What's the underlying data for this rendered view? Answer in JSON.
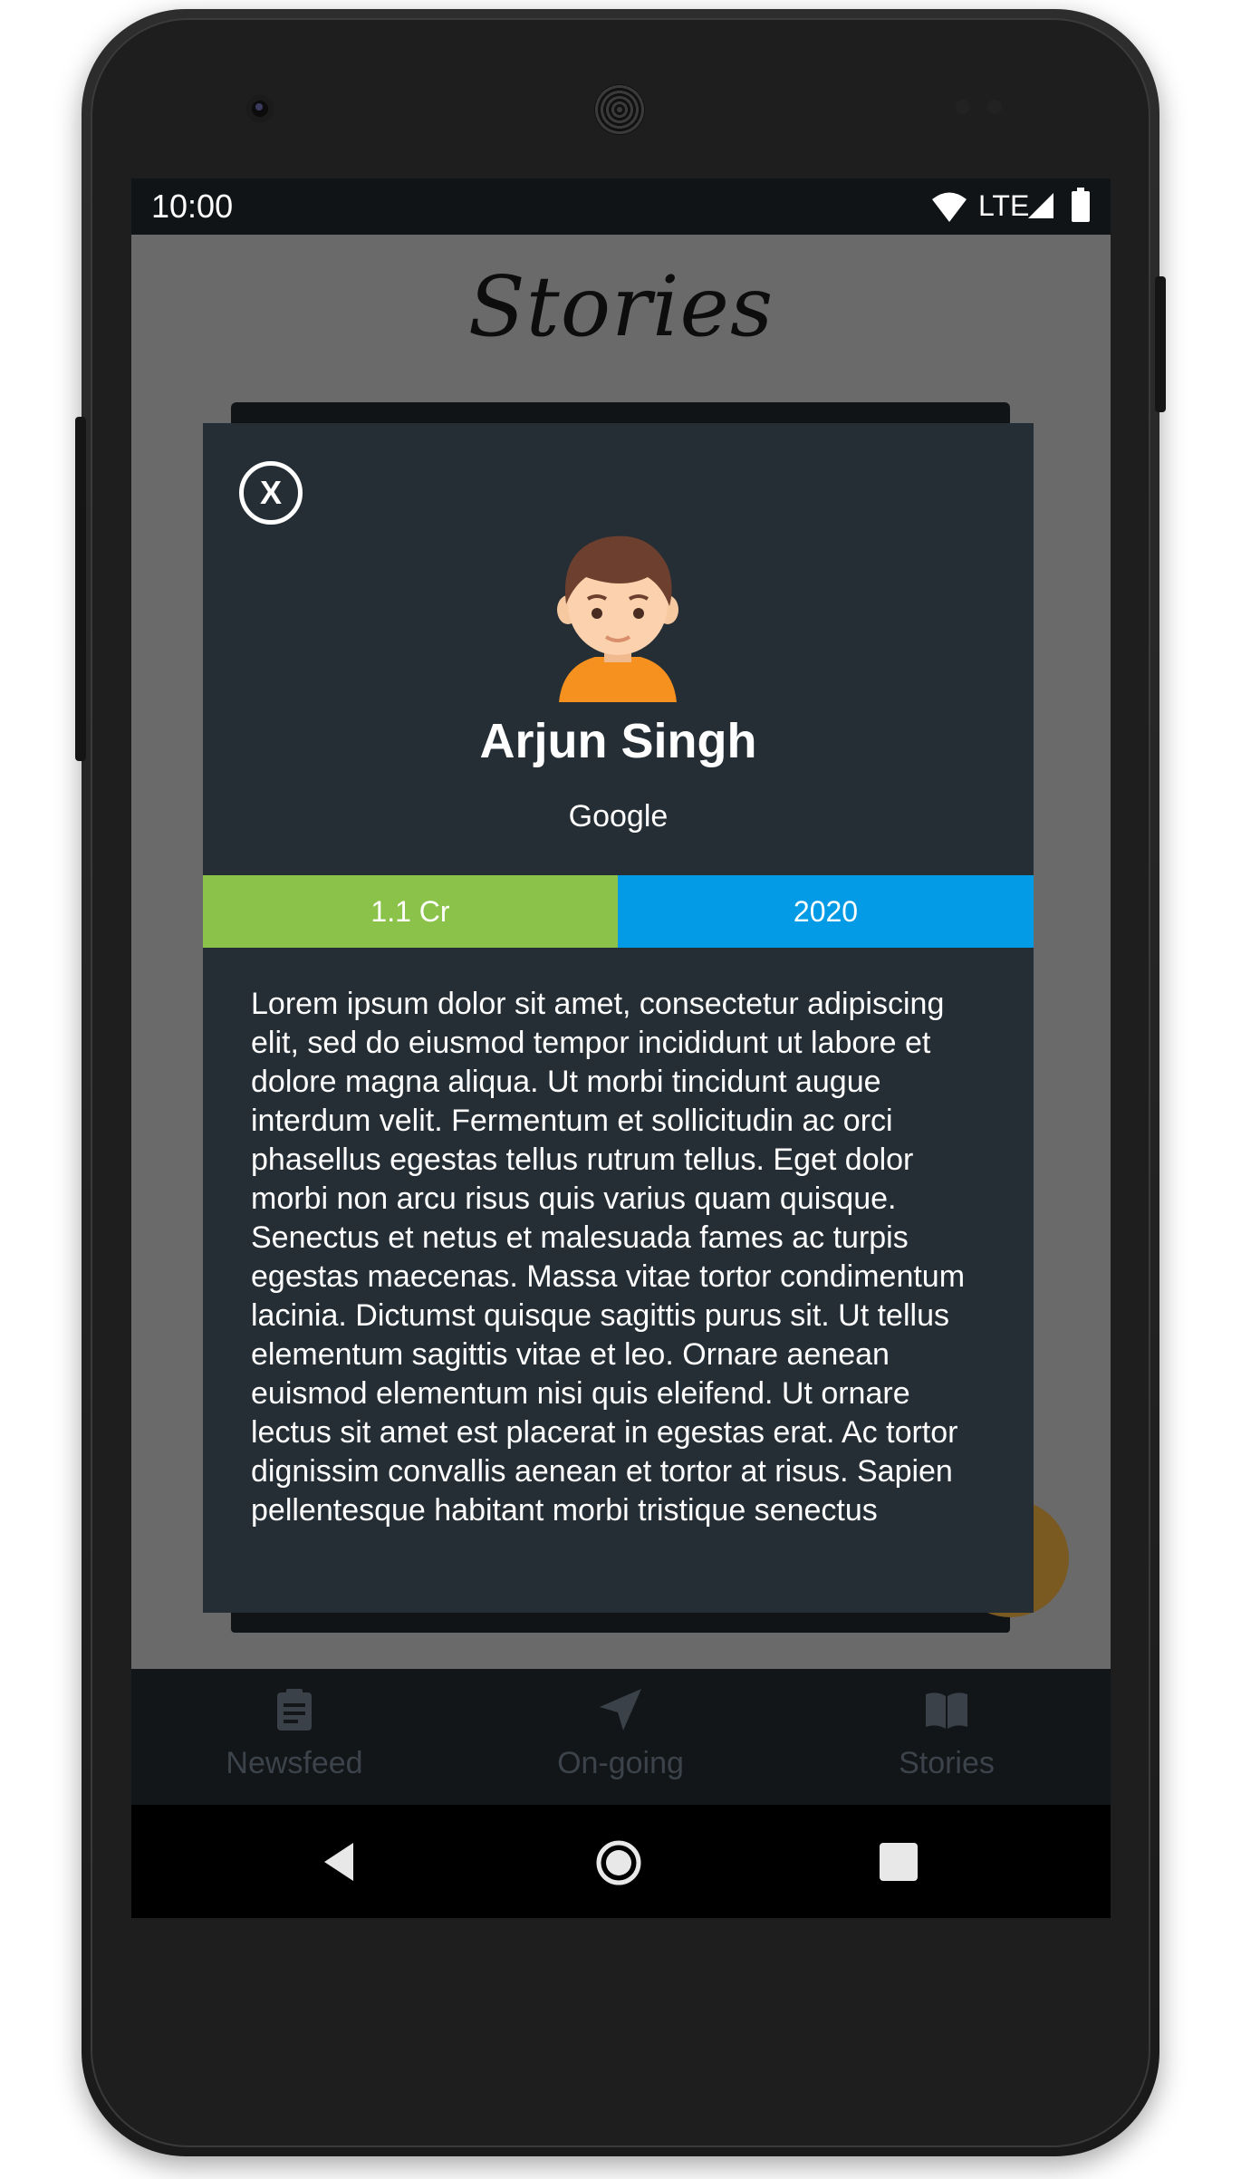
{
  "status_bar": {
    "time": "10:00",
    "network": "LTE",
    "icons": [
      "wifi-icon",
      "signal-icon",
      "battery-icon"
    ]
  },
  "app": {
    "title": "Stories"
  },
  "modal": {
    "close_label": "X",
    "avatar_icon": "boy-avatar-icon",
    "name": "Arjun Singh",
    "company": "Google",
    "salary": "1.1 Cr",
    "year": "2020",
    "story": "Lorem ipsum dolor sit amet, consectetur adipiscing elit, sed do eiusmod tempor incididunt ut labore et dolore magna aliqua. Ut morbi tincidunt augue interdum velit. Fermentum et sollicitudin ac orci phasellus egestas tellus rutrum tellus. Eget dolor morbi non arcu risus quis varius quam quisque. Senectus et netus et malesuada fames ac turpis egestas maecenas. Massa vitae tortor condimentum lacinia. Dictumst quisque sagittis purus sit. Ut tellus elementum sagittis vitae et leo. Ornare aenean euismod elementum nisi quis eleifend. Ut ornare lectus sit amet est placerat in egestas erat. Ac tortor dignissim convallis aenean et tortor at risus. Sapien pellentesque habitant morbi tristique senectus"
  },
  "colors": {
    "salary_bg": "#8bc34a",
    "year_bg": "#039be5",
    "modal_bg": "#252e35"
  },
  "bottom_nav": {
    "items": [
      {
        "label": "Newsfeed",
        "icon": "clipboard-icon"
      },
      {
        "label": "On-going",
        "icon": "navigation-arrow-icon"
      },
      {
        "label": "Stories",
        "icon": "book-icon"
      }
    ]
  },
  "system_nav": {
    "icons": [
      "back-icon",
      "home-icon",
      "recents-icon"
    ]
  }
}
